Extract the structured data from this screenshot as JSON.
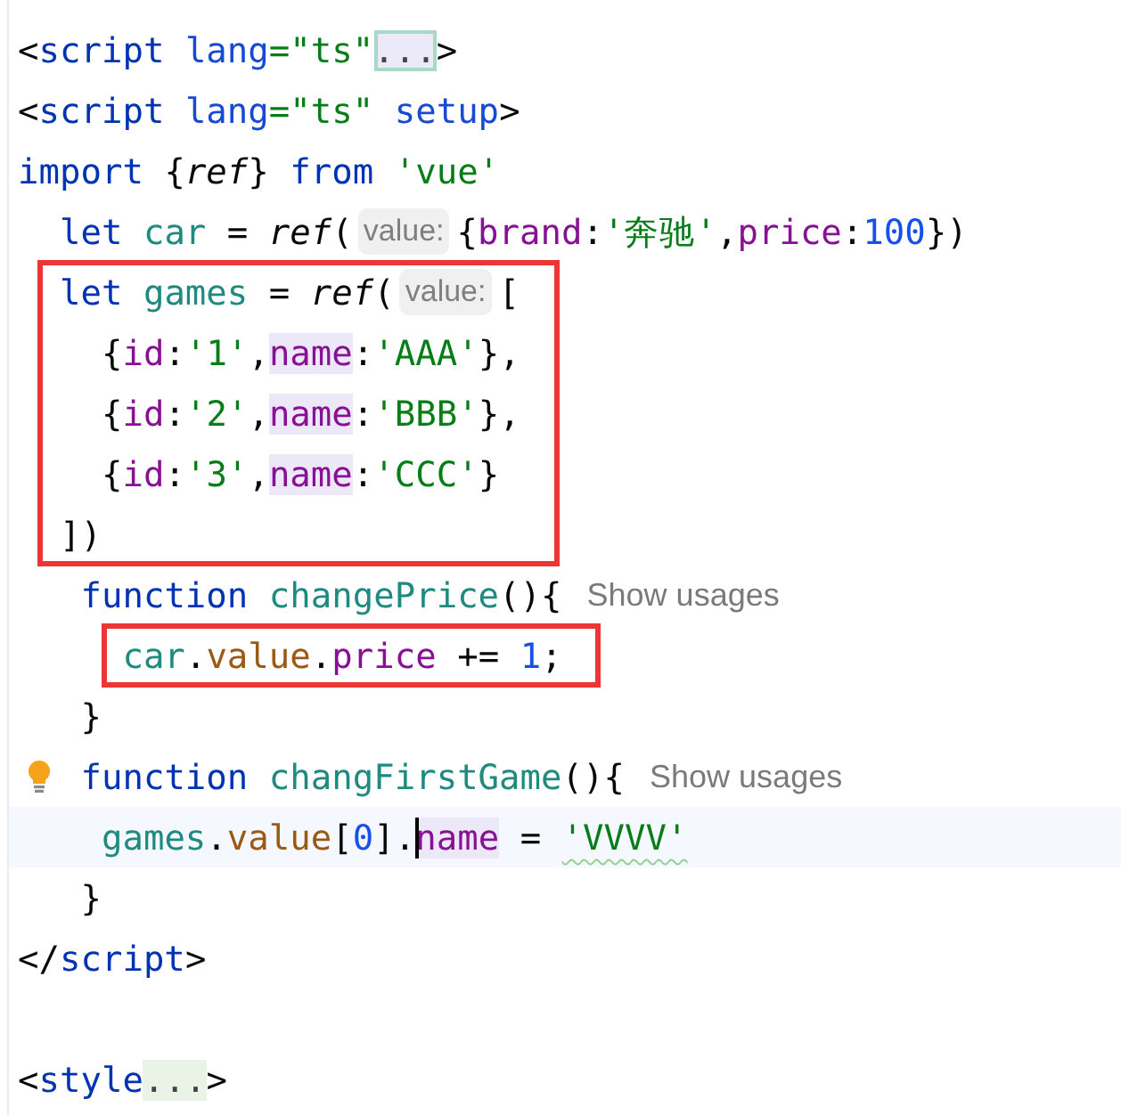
{
  "editor": {
    "blocks": [
      {
        "boxed": false,
        "lines": [
          {
            "segments": [
              {
                "kind": "code",
                "tokens": [
                  {
                    "t": "<",
                    "kind": "plain"
                  },
                  {
                    "t": "script",
                    "kind": "tag"
                  },
                  {
                    "t": " lang",
                    "kind": "attr"
                  },
                  {
                    "t": "=\"ts\"",
                    "kind": "string"
                  }
                ]
              },
              {
                "kind": "fold",
                "text": "...",
                "selected": true
              },
              {
                "kind": "code",
                "tokens": [
                  {
                    "t": ">",
                    "kind": "plain"
                  }
                ]
              }
            ]
          },
          {
            "segments": [
              {
                "kind": "code",
                "tokens": [
                  {
                    "t": "<",
                    "kind": "plain"
                  },
                  {
                    "t": "script",
                    "kind": "tag"
                  },
                  {
                    "t": " lang",
                    "kind": "attr"
                  },
                  {
                    "t": "=\"ts\"",
                    "kind": "string"
                  },
                  {
                    "t": " setup",
                    "kind": "attr"
                  },
                  {
                    "t": ">",
                    "kind": "plain"
                  }
                ]
              }
            ]
          },
          {
            "segments": [
              {
                "kind": "code",
                "tokens": [
                  {
                    "t": "import ",
                    "kind": "keyword"
                  },
                  {
                    "t": "{",
                    "kind": "plain"
                  },
                  {
                    "t": "ref",
                    "kind": "func"
                  },
                  {
                    "t": "} ",
                    "kind": "plain"
                  },
                  {
                    "t": "from ",
                    "kind": "keyword"
                  },
                  {
                    "t": "'vue'",
                    "kind": "string"
                  }
                ]
              }
            ]
          },
          {
            "segments": [
              {
                "kind": "code",
                "tokens": [
                  {
                    "t": "  let ",
                    "kind": "keyword"
                  },
                  {
                    "t": "car",
                    "kind": "var"
                  },
                  {
                    "t": " = ",
                    "kind": "plain"
                  },
                  {
                    "t": "ref",
                    "kind": "func"
                  },
                  {
                    "t": "(",
                    "kind": "plain"
                  }
                ]
              },
              {
                "kind": "hint",
                "text": "value:"
              },
              {
                "kind": "code",
                "tokens": [
                  {
                    "t": "{",
                    "kind": "plain"
                  },
                  {
                    "t": "brand",
                    "kind": "prop"
                  },
                  {
                    "t": ":",
                    "kind": "plain"
                  },
                  {
                    "t": "'奔驰'",
                    "kind": "string"
                  },
                  {
                    "t": ",",
                    "kind": "plain"
                  },
                  {
                    "t": "price",
                    "kind": "prop"
                  },
                  {
                    "t": ":",
                    "kind": "plain"
                  },
                  {
                    "t": "100",
                    "kind": "number"
                  },
                  {
                    "t": "})",
                    "kind": "plain"
                  }
                ]
              }
            ]
          }
        ]
      },
      {
        "boxed": true,
        "lines": [
          {
            "segments": [
              {
                "kind": "code",
                "tokens": [
                  {
                    "t": "  let ",
                    "kind": "keyword"
                  },
                  {
                    "t": "games",
                    "kind": "var"
                  },
                  {
                    "t": " = ",
                    "kind": "plain"
                  },
                  {
                    "t": "ref",
                    "kind": "func"
                  },
                  {
                    "t": "(",
                    "kind": "plain"
                  }
                ]
              },
              {
                "kind": "hint",
                "text": "value:"
              },
              {
                "kind": "code",
                "tokens": [
                  {
                    "t": "[",
                    "kind": "plain"
                  }
                ]
              }
            ]
          },
          {
            "segments": [
              {
                "kind": "code",
                "tokens": [
                  {
                    "t": "    {",
                    "kind": "plain"
                  },
                  {
                    "t": "id",
                    "kind": "prop"
                  },
                  {
                    "t": ":",
                    "kind": "plain"
                  },
                  {
                    "t": "'1'",
                    "kind": "string"
                  },
                  {
                    "t": ",",
                    "kind": "plain"
                  },
                  {
                    "t": "name",
                    "kind": "prop",
                    "highlighted": true
                  },
                  {
                    "t": ":",
                    "kind": "plain"
                  },
                  {
                    "t": "'AAA'",
                    "kind": "string"
                  },
                  {
                    "t": "},",
                    "kind": "plain"
                  }
                ]
              }
            ]
          },
          {
            "segments": [
              {
                "kind": "code",
                "tokens": [
                  {
                    "t": "    {",
                    "kind": "plain"
                  },
                  {
                    "t": "id",
                    "kind": "prop"
                  },
                  {
                    "t": ":",
                    "kind": "plain"
                  },
                  {
                    "t": "'2'",
                    "kind": "string"
                  },
                  {
                    "t": ",",
                    "kind": "plain"
                  },
                  {
                    "t": "name",
                    "kind": "prop",
                    "highlighted": true
                  },
                  {
                    "t": ":",
                    "kind": "plain"
                  },
                  {
                    "t": "'BBB'",
                    "kind": "string"
                  },
                  {
                    "t": "},",
                    "kind": "plain"
                  }
                ]
              }
            ]
          },
          {
            "segments": [
              {
                "kind": "code",
                "tokens": [
                  {
                    "t": "    {",
                    "kind": "plain"
                  },
                  {
                    "t": "id",
                    "kind": "prop"
                  },
                  {
                    "t": ":",
                    "kind": "plain"
                  },
                  {
                    "t": "'3'",
                    "kind": "string"
                  },
                  {
                    "t": ",",
                    "kind": "plain"
                  },
                  {
                    "t": "name",
                    "kind": "prop",
                    "highlighted": true
                  },
                  {
                    "t": ":",
                    "kind": "plain"
                  },
                  {
                    "t": "'CCC'",
                    "kind": "string"
                  },
                  {
                    "t": "}",
                    "kind": "plain"
                  }
                ]
              }
            ]
          },
          {
            "segments": [
              {
                "kind": "code",
                "tokens": [
                  {
                    "t": "  ])",
                    "kind": "plain"
                  }
                ]
              }
            ]
          }
        ]
      },
      {
        "boxed": false,
        "lines": [
          {
            "segments": [
              {
                "kind": "code",
                "tokens": [
                  {
                    "t": "   function ",
                    "kind": "keyword"
                  },
                  {
                    "t": "changePrice",
                    "kind": "var"
                  },
                  {
                    "t": "(){",
                    "kind": "plain"
                  }
                ]
              },
              {
                "kind": "usages",
                "text": "Show usages"
              }
            ]
          }
        ]
      },
      {
        "boxed": true,
        "lines": [
          {
            "segments": [
              {
                "kind": "code",
                "tokens": [
                  {
                    "t": "     car",
                    "kind": "var"
                  },
                  {
                    "t": ".",
                    "kind": "plain"
                  },
                  {
                    "t": "value",
                    "kind": "member"
                  },
                  {
                    "t": ".",
                    "kind": "plain"
                  },
                  {
                    "t": "price",
                    "kind": "prop"
                  },
                  {
                    "t": " += ",
                    "kind": "plain"
                  },
                  {
                    "t": "1",
                    "kind": "number"
                  },
                  {
                    "t": ";",
                    "kind": "plain"
                  }
                ]
              }
            ]
          }
        ]
      },
      {
        "boxed": false,
        "lines": [
          {
            "segments": [
              {
                "kind": "code",
                "tokens": [
                  {
                    "t": "   }",
                    "kind": "plain"
                  }
                ]
              }
            ]
          },
          {
            "bulb": true,
            "segments": [
              {
                "kind": "code",
                "tokens": [
                  {
                    "t": "   function ",
                    "kind": "keyword"
                  },
                  {
                    "t": "changFirstGame",
                    "kind": "var"
                  },
                  {
                    "t": "(){",
                    "kind": "plain"
                  }
                ]
              },
              {
                "kind": "usages",
                "text": "Show usages"
              }
            ]
          },
          {
            "current": true,
            "segments": [
              {
                "kind": "code",
                "tokens": [
                  {
                    "t": "    games",
                    "kind": "var"
                  },
                  {
                    "t": ".",
                    "kind": "plain"
                  },
                  {
                    "t": "value",
                    "kind": "member"
                  },
                  {
                    "t": "[",
                    "kind": "plain"
                  },
                  {
                    "t": "0",
                    "kind": "number"
                  },
                  {
                    "t": "].",
                    "kind": "plain"
                  },
                  {
                    "t": "name",
                    "kind": "prop",
                    "highlighted": true,
                    "caret": true
                  },
                  {
                    "t": " = ",
                    "kind": "plain"
                  },
                  {
                    "t": "'VVVV'",
                    "kind": "string",
                    "typo": true
                  }
                ]
              }
            ]
          },
          {
            "segments": [
              {
                "kind": "code",
                "tokens": [
                  {
                    "t": "   }",
                    "kind": "plain"
                  }
                ]
              }
            ]
          },
          {
            "segments": [
              {
                "kind": "code",
                "tokens": [
                  {
                    "t": "</",
                    "kind": "plain"
                  },
                  {
                    "t": "script",
                    "kind": "tag"
                  },
                  {
                    "t": ">",
                    "kind": "plain"
                  }
                ]
              }
            ]
          },
          {
            "blank": true
          },
          {
            "segments": [
              {
                "kind": "code",
                "tokens": [
                  {
                    "t": "<",
                    "kind": "plain"
                  },
                  {
                    "t": "style",
                    "kind": "tag"
                  }
                ]
              },
              {
                "kind": "fold",
                "text": "...",
                "selected": false
              },
              {
                "kind": "code",
                "tokens": [
                  {
                    "t": ">",
                    "kind": "plain"
                  }
                ]
              }
            ]
          }
        ]
      }
    ]
  }
}
